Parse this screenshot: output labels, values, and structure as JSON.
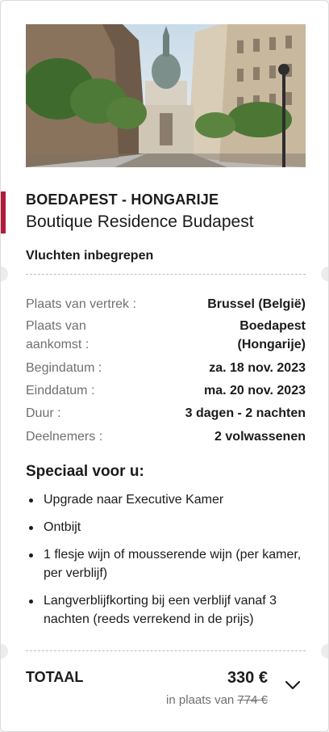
{
  "card": {
    "destination": "BOEDAPEST - HONGARIJE",
    "hotel_name": "Boutique Residence Budapest",
    "flights": "Vluchten inbegrepen",
    "accent_color": "#b01c3a",
    "details": [
      {
        "label": "Plaats van vertrek :",
        "value": "Brussel (België)"
      },
      {
        "label": "Plaats van aankomst :",
        "value": "Boedapest (Hongarije)"
      },
      {
        "label": "Begindatum :",
        "value": "za. 18 nov. 2023"
      },
      {
        "label": "Einddatum :",
        "value": "ma. 20 nov. 2023"
      },
      {
        "label": "Duur :",
        "value": "3 dagen - 2 nachten"
      },
      {
        "label": "Deelnemers :",
        "value": "2 volwassenen"
      }
    ],
    "special_title": "Speciaal voor u:",
    "specials": [
      "Upgrade naar Executive Kamer",
      "Ontbijt",
      "1 flesje wijn of mousserende wijn (per kamer, per verblijf)",
      "Langverblijfkorting bij een verblijf vanaf 3 nachten (reeds verrekend in de prijs)"
    ],
    "total_label": "TOTAAL",
    "price": "330 €",
    "instead_label": "in plaats van",
    "old_price": "774 €",
    "expand_icon": "chevron-down-icon"
  }
}
